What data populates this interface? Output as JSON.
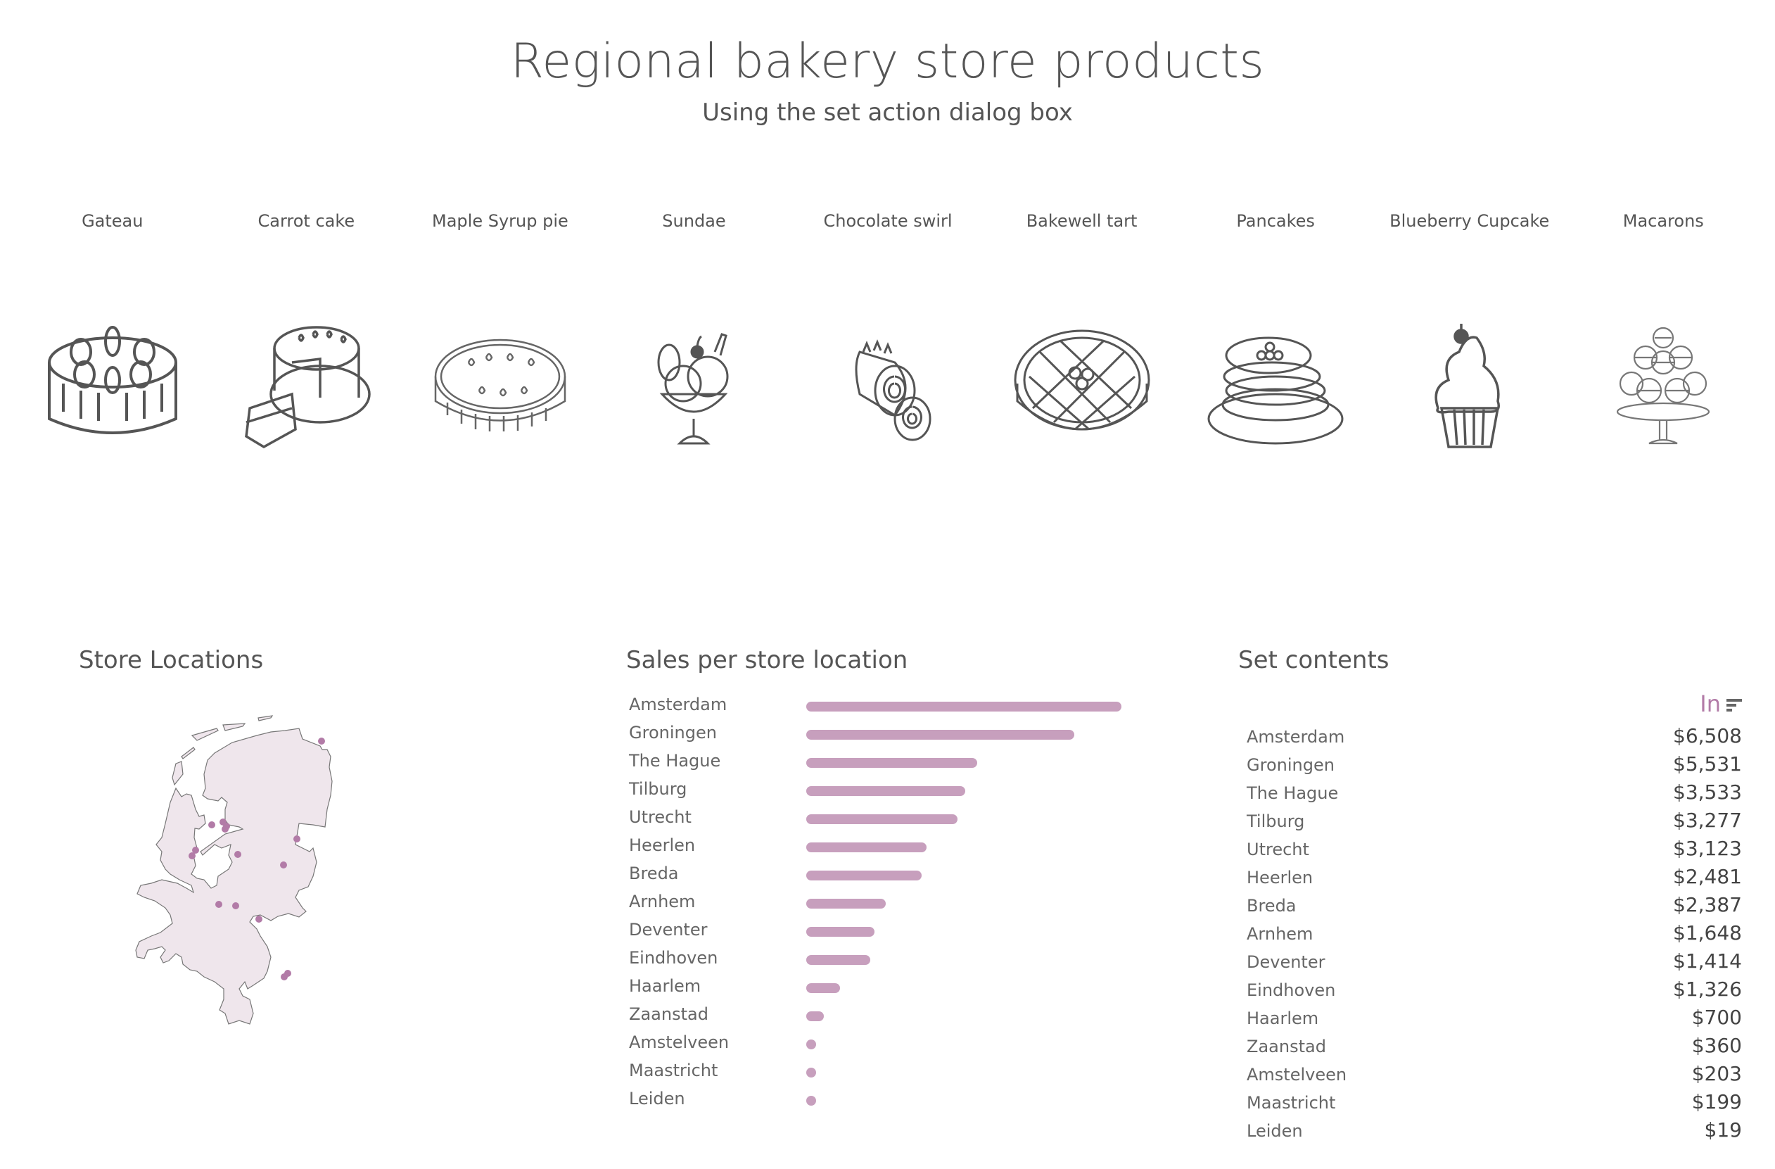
{
  "header": {
    "title": "Regional bakery store products",
    "subtitle": "Using the set action dialog box"
  },
  "products": [
    {
      "label": "Gateau",
      "icon": "gateau-icon"
    },
    {
      "label": "Carrot cake",
      "icon": "carrot-cake-icon"
    },
    {
      "label": "Maple Syrup pie",
      "icon": "pie-icon"
    },
    {
      "label": "Sundae",
      "icon": "sundae-icon"
    },
    {
      "label": "Chocolate swirl",
      "icon": "swiss-roll-icon"
    },
    {
      "label": "Bakewell tart",
      "icon": "lattice-tart-icon"
    },
    {
      "label": "Pancakes",
      "icon": "pancakes-icon"
    },
    {
      "label": "Blueberry Cupcake",
      "icon": "cupcake-icon"
    },
    {
      "label": "Macarons",
      "icon": "macarons-icon"
    }
  ],
  "map": {
    "title": "Store Locations",
    "fill_color": "#efe6ec",
    "dot_color": "#b27ba7",
    "stores": [
      "Groningen",
      "Haarlem",
      "Amsterdam",
      "Zaanstad",
      "Amstelveen",
      "Deventer",
      "The Hague",
      "Leiden",
      "Utrecht",
      "Arnhem",
      "Breda",
      "Tilburg",
      "Eindhoven",
      "Heerlen",
      "Maastricht"
    ]
  },
  "sales": {
    "title": "Sales per store location"
  },
  "set_contents": {
    "title": "Set contents",
    "column_header": "In",
    "sort_icon": "sort-descending-icon",
    "accent_color": "#b27ba7",
    "rows": [
      {
        "city": "Amsterdam",
        "value": "$6,508"
      },
      {
        "city": "Groningen",
        "value": "$5,531"
      },
      {
        "city": "The Hague",
        "value": "$3,533"
      },
      {
        "city": "Tilburg",
        "value": "$3,277"
      },
      {
        "city": "Utrecht",
        "value": "$3,123"
      },
      {
        "city": "Heerlen",
        "value": "$2,481"
      },
      {
        "city": "Breda",
        "value": "$2,387"
      },
      {
        "city": "Arnhem",
        "value": "$1,648"
      },
      {
        "city": "Deventer",
        "value": "$1,414"
      },
      {
        "city": "Eindhoven",
        "value": "$1,326"
      },
      {
        "city": "Haarlem",
        "value": "$700"
      },
      {
        "city": "Zaanstad",
        "value": "$360"
      },
      {
        "city": "Amstelveen",
        "value": "$203"
      },
      {
        "city": "Maastricht",
        "value": "$199"
      },
      {
        "city": "Leiden",
        "value": "$19"
      }
    ]
  },
  "chart_data": {
    "type": "bar",
    "orientation": "horizontal",
    "title": "Sales per store location",
    "xlabel": "",
    "ylabel": "",
    "bar_color": "#c79fbd",
    "categories": [
      "Amsterdam",
      "Groningen",
      "The Hague",
      "Tilburg",
      "Utrecht",
      "Heerlen",
      "Breda",
      "Arnhem",
      "Deventer",
      "Eindhoven",
      "Haarlem",
      "Zaanstad",
      "Amstelveen",
      "Maastricht",
      "Leiden"
    ],
    "values": [
      6508,
      5531,
      3533,
      3277,
      3123,
      2481,
      2387,
      1648,
      1414,
      1326,
      700,
      360,
      203,
      199,
      19
    ],
    "xlim": [
      0,
      6508
    ],
    "grid": false,
    "legend": "none"
  }
}
